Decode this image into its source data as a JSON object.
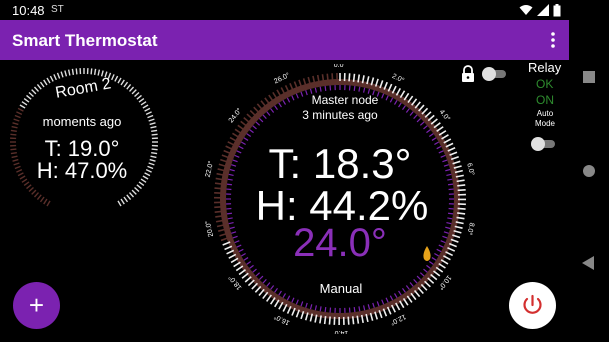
{
  "status_bar": {
    "time": "10:48",
    "carrier": "ST"
  },
  "app_bar": {
    "title": "Smart Thermostat"
  },
  "room2": {
    "name": "Room 2",
    "updated": "moments ago",
    "temperature": "T: 19.0°",
    "humidity": "H: 47.0%"
  },
  "master": {
    "name": "Master node",
    "updated": "3 minutes ago",
    "temperature": "T: 18.3°",
    "humidity": "H: 44.2%",
    "setpoint": "24.0°",
    "mode": "Manual",
    "scale_labels": [
      "0.0°",
      "2.0°",
      "4.0°",
      "6.0°",
      "8.0°",
      "10.0°",
      "12.0°",
      "14.0°",
      "16.0°",
      "18.0°",
      "20.0°",
      "22.0°",
      "24.0°",
      "26.0°"
    ]
  },
  "relay": {
    "label": "Relay",
    "status_ok": "OK",
    "status_on": "ON",
    "auto_mode_label": "Auto\nMode"
  },
  "colors": {
    "accent": "#7b22b0",
    "ok_green": "#2e8b2e",
    "setpoint_purple": "#8a2fb8",
    "flame": "#e6a21a"
  }
}
